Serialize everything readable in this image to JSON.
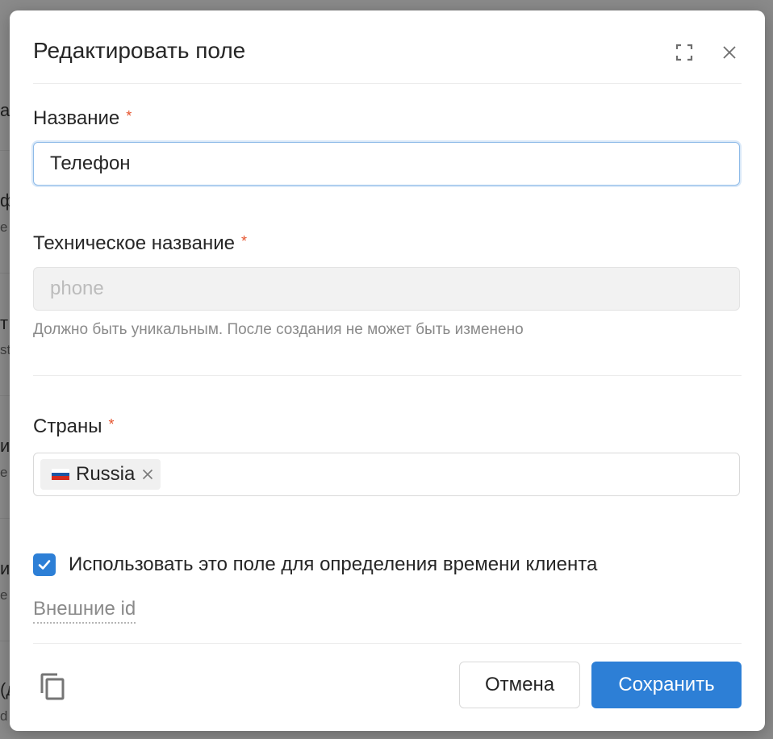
{
  "background": {
    "fragments": [
      "а",
      "ф",
      "е",
      "т",
      "st",
      "и",
      "е",
      "и",
      "е",
      "(д",
      "d"
    ]
  },
  "modal": {
    "title": "Редактировать поле",
    "expand_icon": "expand-icon",
    "close_icon": "close-icon"
  },
  "fields": {
    "name": {
      "label": "Название",
      "required_mark": "*",
      "value": "Телефон"
    },
    "tech_name": {
      "label": "Техническое название",
      "required_mark": "*",
      "placeholder": "phone",
      "hint": "Должно быть уникальным. После создания не может быть изменено"
    },
    "countries": {
      "label": "Страны",
      "required_mark": "*",
      "selected": [
        {
          "label": "Russia",
          "flag": "russia-flag"
        }
      ]
    }
  },
  "checkbox": {
    "checked": true,
    "label": "Использовать это поле для определения времени клиента"
  },
  "external_ids_link": "Внешние id",
  "footer": {
    "copy_icon": "copy-icon",
    "cancel_label": "Отмена",
    "save_label": "Сохранить"
  },
  "colors": {
    "accent": "#2d7fd6",
    "required": "#e5532d",
    "flag_white": "#ffffff",
    "flag_blue": "#1c57a5",
    "flag_red": "#d52b1e"
  }
}
